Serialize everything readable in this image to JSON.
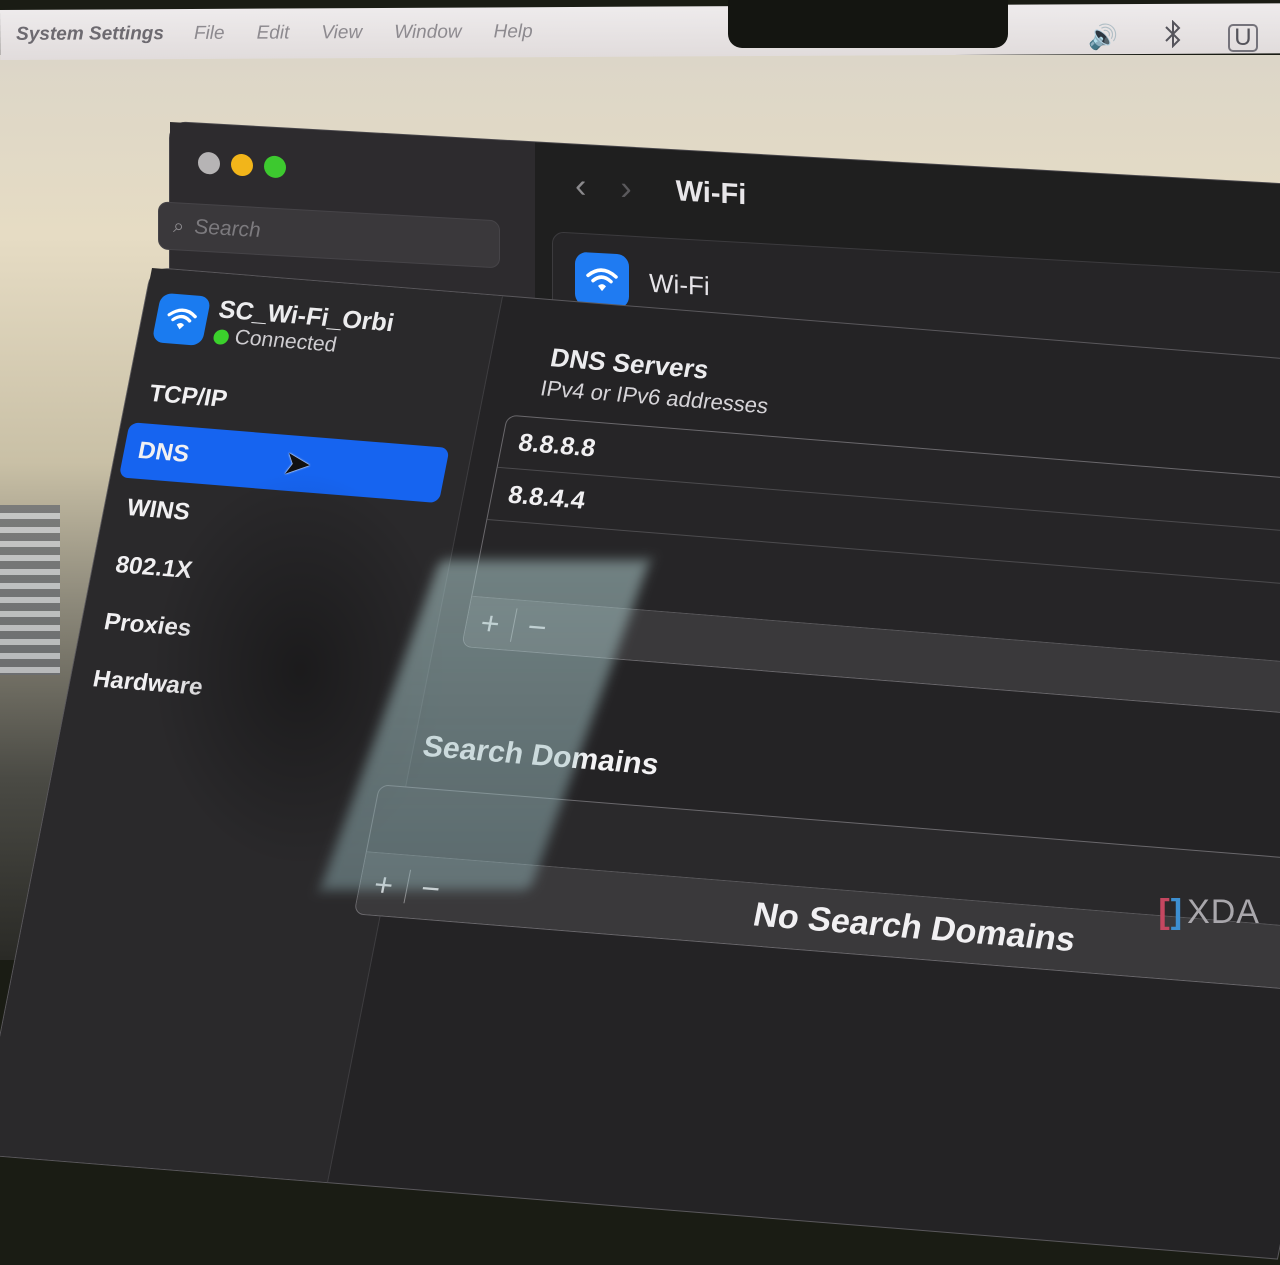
{
  "menubar": {
    "app_name": "System Settings",
    "items": [
      "File",
      "Edit",
      "View",
      "Window",
      "Help"
    ],
    "status_icons": [
      {
        "name": "volume-icon",
        "glyph": "🔊"
      },
      {
        "name": "bluetooth-icon",
        "glyph": "✱"
      },
      {
        "name": "input-source-icon",
        "glyph": "U"
      }
    ]
  },
  "window": {
    "search_placeholder": "Search",
    "nav": {
      "back": "‹",
      "forward": "›",
      "title": "Wi-Fi"
    },
    "wifi_row_label": "Wi-Fi"
  },
  "sheet": {
    "network": {
      "name": "SC_Wi-Fi_Orbi",
      "status": "Connected"
    },
    "sidebar_items": [
      {
        "label": "TCP/IP",
        "active": false
      },
      {
        "label": "DNS",
        "active": true
      },
      {
        "label": "WINS",
        "active": false
      },
      {
        "label": "802.1X",
        "active": false
      },
      {
        "label": "Proxies",
        "active": false
      },
      {
        "label": "Hardware",
        "active": false
      }
    ],
    "dns_servers": {
      "title": "DNS Servers",
      "subtitle": "IPv4 or IPv6 addresses",
      "entries": [
        "8.8.8.8",
        "8.8.4.4"
      ],
      "add_label": "+",
      "remove_label": "−"
    },
    "search_domains": {
      "title": "Search Domains",
      "empty_text": "No Search Domains",
      "add_label": "+",
      "remove_label": "−"
    }
  },
  "colors": {
    "accent": "#1664f0",
    "wifi_tile": "#1a7bf0",
    "connected": "#3bd12c"
  },
  "watermark": {
    "bracket_left": "[",
    "bracket_right": "]",
    "text": "XDA"
  }
}
